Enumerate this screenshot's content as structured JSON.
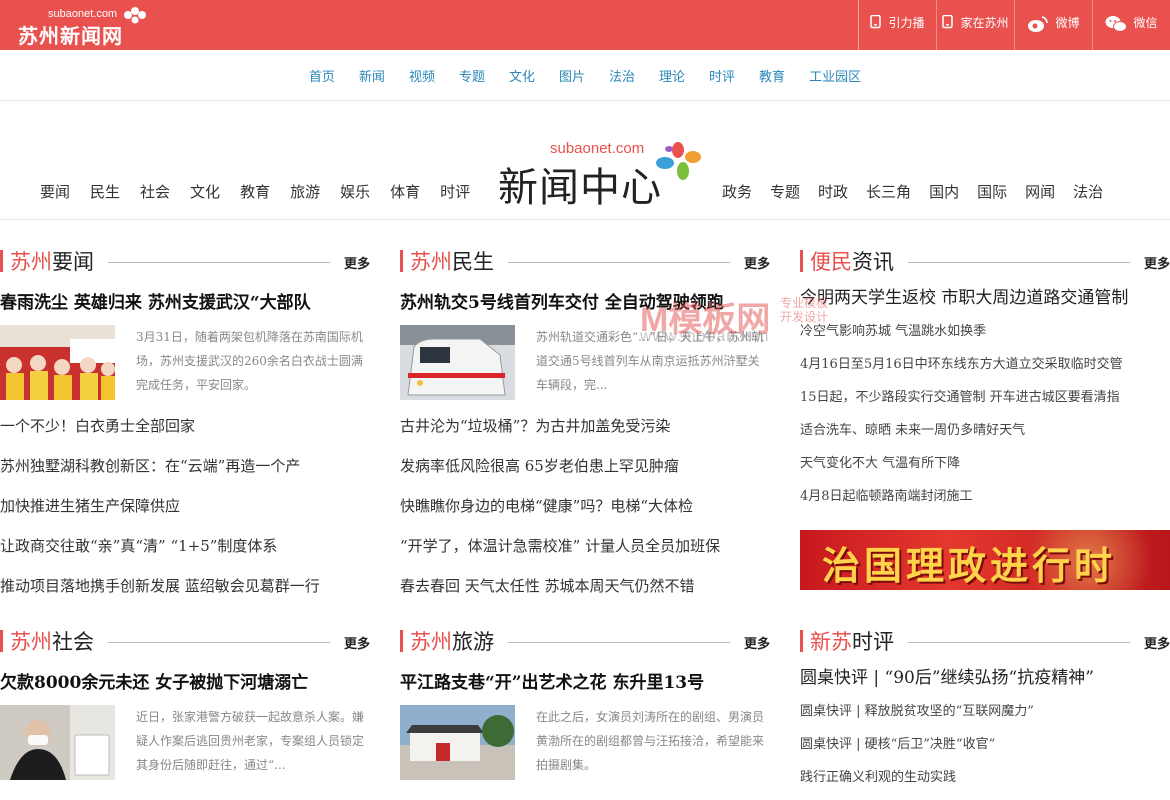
{
  "brand": {
    "domain": "subaonet.com",
    "name": "苏州新闻网",
    "colors": {
      "accent": "#e9514f",
      "link": "#2a88b9"
    }
  },
  "toplinks": [
    {
      "label": "引力播",
      "icon": "mobile-icon"
    },
    {
      "label": "家在苏州",
      "icon": "mobile-icon"
    },
    {
      "label": "微博",
      "icon": "weibo-icon"
    },
    {
      "label": "微信",
      "icon": "wechat-icon"
    }
  ],
  "nav": [
    "首页",
    "新闻",
    "视频",
    "专题",
    "文化",
    "图片",
    "法治",
    "理论",
    "时评",
    "教育",
    "工业园区"
  ],
  "header": {
    "logo_domain": "subaonet.com",
    "logo_text": "新闻中心",
    "left_links": [
      "要闻",
      "民生",
      "社会",
      "文化",
      "教育",
      "旅游",
      "娱乐",
      "体育",
      "时评"
    ],
    "right_links": [
      "政务",
      "专题",
      "时政",
      "长三角",
      "国内",
      "国际",
      "网闻",
      "法治"
    ]
  },
  "more_label": "更多",
  "sections": {
    "yaowen": {
      "title_red": "苏州",
      "title_black": "要闻",
      "lead": "春雨洗尘 英雄归来 苏州支援武汉“大部队",
      "summary": "3月31日，随着两架包机降落在苏南国际机场，苏州支援武汉的260余名白衣战士圆满完成任务，平安回家。",
      "items": [
        "一个不少！白衣勇士全部回家",
        "苏州独墅湖科教创新区：在“云端”再造一个产",
        "加快推进生猪生产保障供应",
        "让政商交往敢“亲”真“清” “1+5”制度体系",
        "推动项目落地携手创新发展 蓝绍敏会见葛群一行"
      ]
    },
    "minsheng": {
      "title_red": "苏州",
      "title_black": "民生",
      "lead": "苏州轨交5号线首列车交付 全自动驾驶领跑",
      "summary": "苏州轨道交通彩色“...”日，天上午，苏州轨道交通5号线首列车从南京运抵苏州浒墅关车辆段，完...",
      "items": [
        "古井沦为“垃圾桶”？为古井加盖免受污染",
        "发病率低风险很高 65岁老伯患上罕见肿瘤",
        "快瞧瞧你身边的电梯“健康”吗？电梯“大体检",
        "“开学了，体温计急需校准” 计量人员全员加班保",
        "春去春回 天气太任性 苏城本周天气仍然不错"
      ]
    },
    "bianmin": {
      "title_red": "便民",
      "title_black": "资讯",
      "items": [
        "今明两天学生返校 市职大周边道路交通管制",
        "冷空气影响苏城 气温跳水如换季",
        "4月16日至5月16日中环东线东方大道立交采取临时交管",
        "15日起，不少路段实行交通管制 开车进古城区要看清指",
        "适合洗车、晾晒 未来一周仍多晴好天气",
        "天气变化不大 气温有所下降",
        "4月8日起临顿路南端封闭施工"
      ],
      "banner": "治国理政进行时"
    },
    "shehui": {
      "title_red": "苏州",
      "title_black": "社会",
      "lead": "欠款8000余元未还 女子被抛下河塘溺亡",
      "summary": "近日，张家港警方破获一起故意杀人案。嫌疑人作案后逃回贵州老家，专案组人员锁定其身份后随即赶往，通过“..."
    },
    "lvyou": {
      "title_red": "苏州",
      "title_black": "旅游",
      "lead": "平江路支巷“开”出艺术之花 东升里13号",
      "summary": "在此之后，女演员刘涛所在的剧组、男演员黄渤所在的剧组都曾与汪拓接洽，希望能来拍摄剧集。"
    },
    "shiping": {
      "title_red": "新苏",
      "title_black": "时评",
      "items": [
        "圆桌快评 | “90后”继续弘扬“抗疫精神”",
        "圆桌快评 | 释放脱贫攻坚的“互联网魔力”",
        "圆桌快评 | 硬核“后卫”决胜“收官”",
        "践行正确义利观的生动实践"
      ]
    }
  },
  "watermark": {
    "big": "模板网",
    "url": "www.moban.kim",
    "side1": "专业模板",
    "side2": "开发设计"
  }
}
